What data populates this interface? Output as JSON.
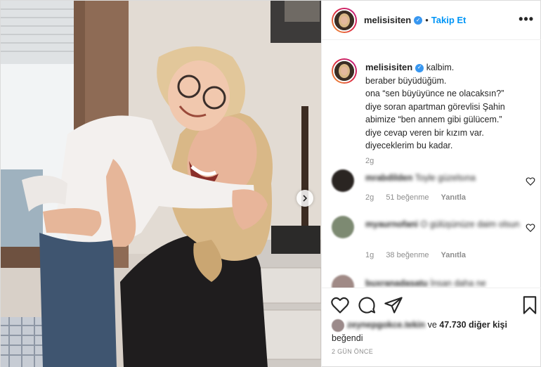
{
  "header": {
    "username": "melisisiten",
    "separator": "•",
    "follow_label": "Takip Et",
    "more_label": "•••"
  },
  "caption": {
    "username": "melisisiten",
    "lines": [
      "kalbim.",
      "beraber büyüdüğüm.",
      "ona “sen büyüyünce ne olacaksın?”",
      "diye soran apartman görevlisi Şahin",
      "abimize “ben annem gibi gülücem.”",
      "diye cevap veren bir kızım var.",
      "diyeceklerim bu kadar."
    ],
    "time": "2g"
  },
  "comments": [
    {
      "username": "mrabdilden",
      "text": "Toyle güzelsına",
      "time": "2g",
      "likes": "51 beğenme",
      "reply": "Yanıtla",
      "avatar_color": "#2a2522"
    },
    {
      "username": "myaurnofani",
      "text": "O gülüşünüze daim olsun",
      "time": "1g",
      "likes": "38 beğenme",
      "reply": "Yanıtla",
      "avatar_color": "#7d8a72"
    },
    {
      "username": "buxranadasatu",
      "text": "İnsan daha ne",
      "avatar_color": "#a08a86"
    }
  ],
  "likes": {
    "blurred_user": "zeynepgokce.tekin",
    "connector": "ve",
    "count_text": "47.730 diğer kişi",
    "suffix": "beğendi"
  },
  "timestamp": "2 GÜN ÖNCE",
  "colors": {
    "accent": "#0095f6",
    "verified": "#3897f0",
    "muted": "#8e8e8e",
    "border": "#efefef"
  },
  "icons": {
    "like": "heart-icon",
    "comment": "comment-bubble-icon",
    "share": "paper-plane-icon",
    "save": "bookmark-icon",
    "next": "chevron-right-icon"
  }
}
